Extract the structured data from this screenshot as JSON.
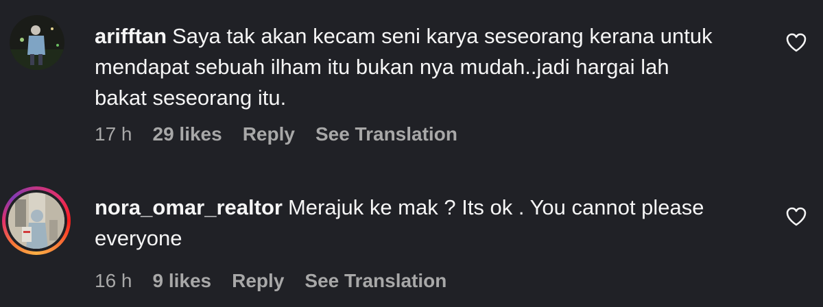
{
  "comments": [
    {
      "username": "arifftan",
      "text": "Saya tak akan kecam seni karya seseorang kerana untuk mendapat sebuah ilham itu bukan nya mudah..jadi hargai lah bakat seseorang itu.",
      "time": "17 h",
      "likes": "29 likes",
      "reply_label": "Reply",
      "translate_label": "See Translation",
      "avatar_icon": "avatar-photo",
      "has_story_ring": false
    },
    {
      "username": "nora_omar_realtor",
      "text": "Merajuk ke mak ? Its ok . You cannot please everyone",
      "time": "16 h",
      "likes": "9 likes",
      "reply_label": "Reply",
      "translate_label": "See Translation",
      "avatar_icon": "avatar-photo",
      "has_story_ring": true
    }
  ],
  "colors": {
    "background": "#202126",
    "text": "#f5f5f5",
    "meta": "#a8a8a8",
    "story_ring": [
      "#c13584",
      "#fcaf45"
    ]
  },
  "icons": {
    "like": "heart-outline-icon"
  }
}
